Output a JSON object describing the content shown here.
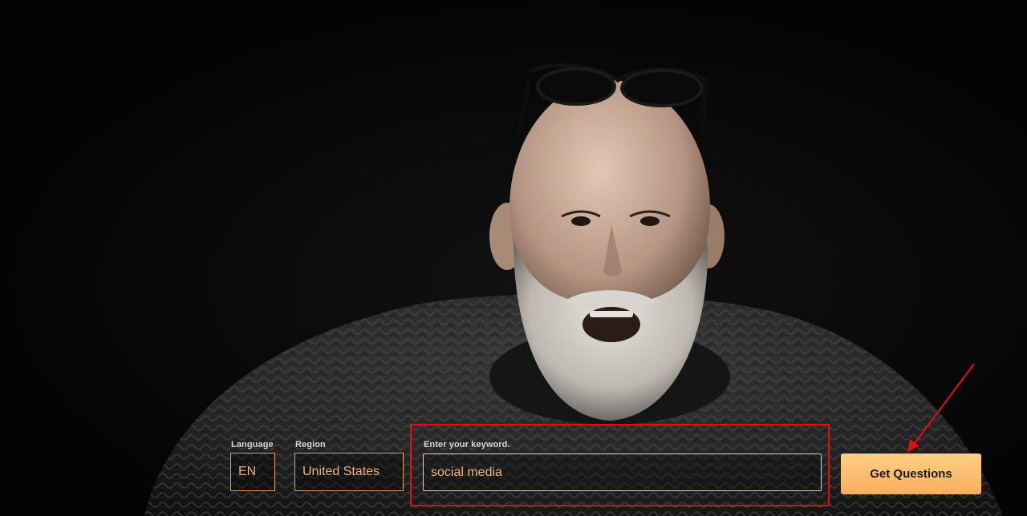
{
  "hero": {
    "description_icon": "portrait-image"
  },
  "form": {
    "language": {
      "label": "Language",
      "value": "EN"
    },
    "region": {
      "label": "Region",
      "value": "United States"
    },
    "keyword": {
      "label": "Enter your keyword.",
      "value": "social media"
    },
    "submit_label": "Get Questions"
  },
  "colors": {
    "accent": "#f6ae5c",
    "field_text": "#f2b373",
    "annotation": "#e01010"
  }
}
